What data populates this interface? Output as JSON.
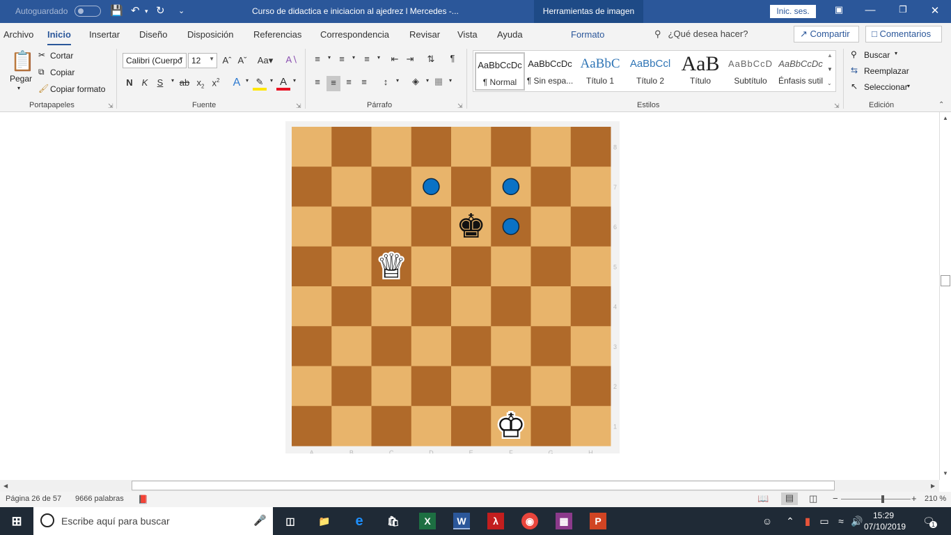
{
  "titlebar": {
    "autosave_label": "Autoguardado",
    "document_title": "Curso de didactica e iniciacion al ajedrez l Mercedes  -...",
    "contextual_tab": "Herramientas de imagen",
    "signin_label": "Inic. ses."
  },
  "tabs": [
    "Archivo",
    "Inicio",
    "Insertar",
    "Diseño",
    "Disposición",
    "Referencias",
    "Correspondencia",
    "Revisar",
    "Vista",
    "Ayuda",
    "Formato"
  ],
  "tellme": "¿Qué desea hacer?",
  "share_label": "Compartir",
  "comments_label": "Comentarios",
  "clipboard": {
    "paste": "Pegar",
    "cut": "Cortar",
    "copy": "Copiar",
    "format_painter": "Copiar formato",
    "group": "Portapapeles"
  },
  "font": {
    "name": "Calibri (Cuerpo",
    "size": "12",
    "bold": "N",
    "italic": "K",
    "underline": "S",
    "strike": "ab",
    "subscript": "x",
    "superscript": "x",
    "case": "Aa",
    "group": "Fuente"
  },
  "paragraph": {
    "pilcrow": "¶",
    "group": "Párrafo"
  },
  "styles": {
    "items": [
      {
        "sample": "AaBbCcDc",
        "name": "¶ Normal"
      },
      {
        "sample": "AaBbCcDc",
        "name": "¶ Sin espa..."
      },
      {
        "sample": "AaBbC",
        "name": "Título 1"
      },
      {
        "sample": "AaBbCcl",
        "name": "Título 2"
      },
      {
        "sample": "AaB",
        "name": "Título"
      },
      {
        "sample": "AaBbCcD",
        "name": "Subtítulo"
      },
      {
        "sample": "AaBbCcDc",
        "name": "Énfasis sutil"
      }
    ],
    "group": "Estilos"
  },
  "editing": {
    "find": "Buscar",
    "replace": "Reemplazar",
    "select": "Seleccionar",
    "group": "Edición"
  },
  "board": {
    "files": [
      "A",
      "B",
      "C",
      "D",
      "E",
      "F",
      "G",
      "H"
    ],
    "ranks": [
      "8",
      "7",
      "6",
      "5",
      "4",
      "3",
      "2",
      "1"
    ],
    "light_color": "#e8b46b",
    "dark_color": "#b06a2a",
    "marker_color": "#0a72c6",
    "pieces": [
      {
        "piece": "black-king",
        "square": "e6"
      },
      {
        "piece": "white-queen",
        "square": "c5"
      },
      {
        "piece": "white-king",
        "square": "f1"
      }
    ],
    "markers": [
      "d7",
      "f7",
      "f6"
    ]
  },
  "status": {
    "page": "Página 26 de 57",
    "words": "9666 palabras",
    "zoom": "210 %"
  },
  "taskbar": {
    "search_placeholder": "Escribe aquí para buscar",
    "time": "15:29",
    "date": "07/10/2019",
    "notifications": "1"
  }
}
